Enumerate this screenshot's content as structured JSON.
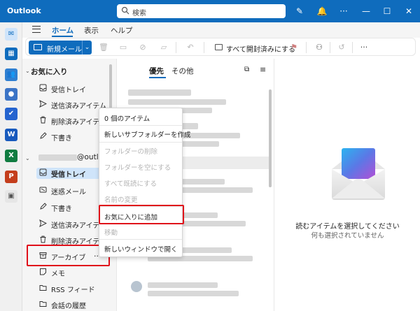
{
  "app": {
    "title": "Outlook"
  },
  "search": {
    "placeholder": "検索"
  },
  "ribbon_tabs": [
    "ホーム",
    "表示",
    "ヘルプ"
  ],
  "toolbar": {
    "new_mail_label": "新規メール",
    "mark_all_read_label": "すべて開封済みにする"
  },
  "folders": {
    "favorites_header": "お気に入り",
    "favorites": [
      {
        "label": "受信トレイ",
        "icon": "inbox-icon"
      },
      {
        "label": "送信済みアイテム",
        "icon": "send-icon"
      },
      {
        "label": "削除済みアイテム",
        "icon": "trash-icon"
      },
      {
        "label": "下書き",
        "icon": "draft-icon"
      }
    ],
    "account_header": "@outl...",
    "account": [
      {
        "label": "受信トレイ",
        "icon": "inbox-icon"
      },
      {
        "label": "迷惑メール",
        "icon": "junk-icon"
      },
      {
        "label": "下書き",
        "icon": "draft-icon"
      },
      {
        "label": "送信済みアイテム",
        "icon": "send-icon"
      },
      {
        "label": "削除済みアイテム",
        "icon": "trash-icon"
      },
      {
        "label": "アーカイブ",
        "icon": "archive-icon"
      },
      {
        "label": "メモ",
        "icon": "note-icon"
      },
      {
        "label": "RSS フィード",
        "icon": "folder-icon"
      },
      {
        "label": "会話の履歴",
        "icon": "folder-icon"
      }
    ],
    "more_label": "..."
  },
  "message_list": {
    "tabs": [
      "優先",
      "その他"
    ]
  },
  "context_menu": {
    "items": [
      {
        "label": "0 個のアイテム",
        "disabled": false
      },
      {
        "label": "新しいサブフォルダーを作成",
        "disabled": false
      },
      {
        "label": "フォルダーの削除",
        "disabled": true
      },
      {
        "label": "フォルダーを空にする",
        "disabled": true
      },
      {
        "label": "すべて既読にする",
        "disabled": true
      },
      {
        "label": "名前の変更",
        "disabled": true
      },
      {
        "label": "お気に入りに追加",
        "disabled": false
      },
      {
        "label": "移動",
        "disabled": true
      },
      {
        "label": "新しいウィンドウで開く",
        "disabled": false
      }
    ]
  },
  "reading_pane": {
    "empty_title": "読むアイテムを選択してください",
    "empty_subtitle": "何も選択されていません"
  },
  "colors": {
    "accent": "#0f6cbd",
    "highlight": "#e0101a",
    "selected": "#cfe4fa"
  }
}
